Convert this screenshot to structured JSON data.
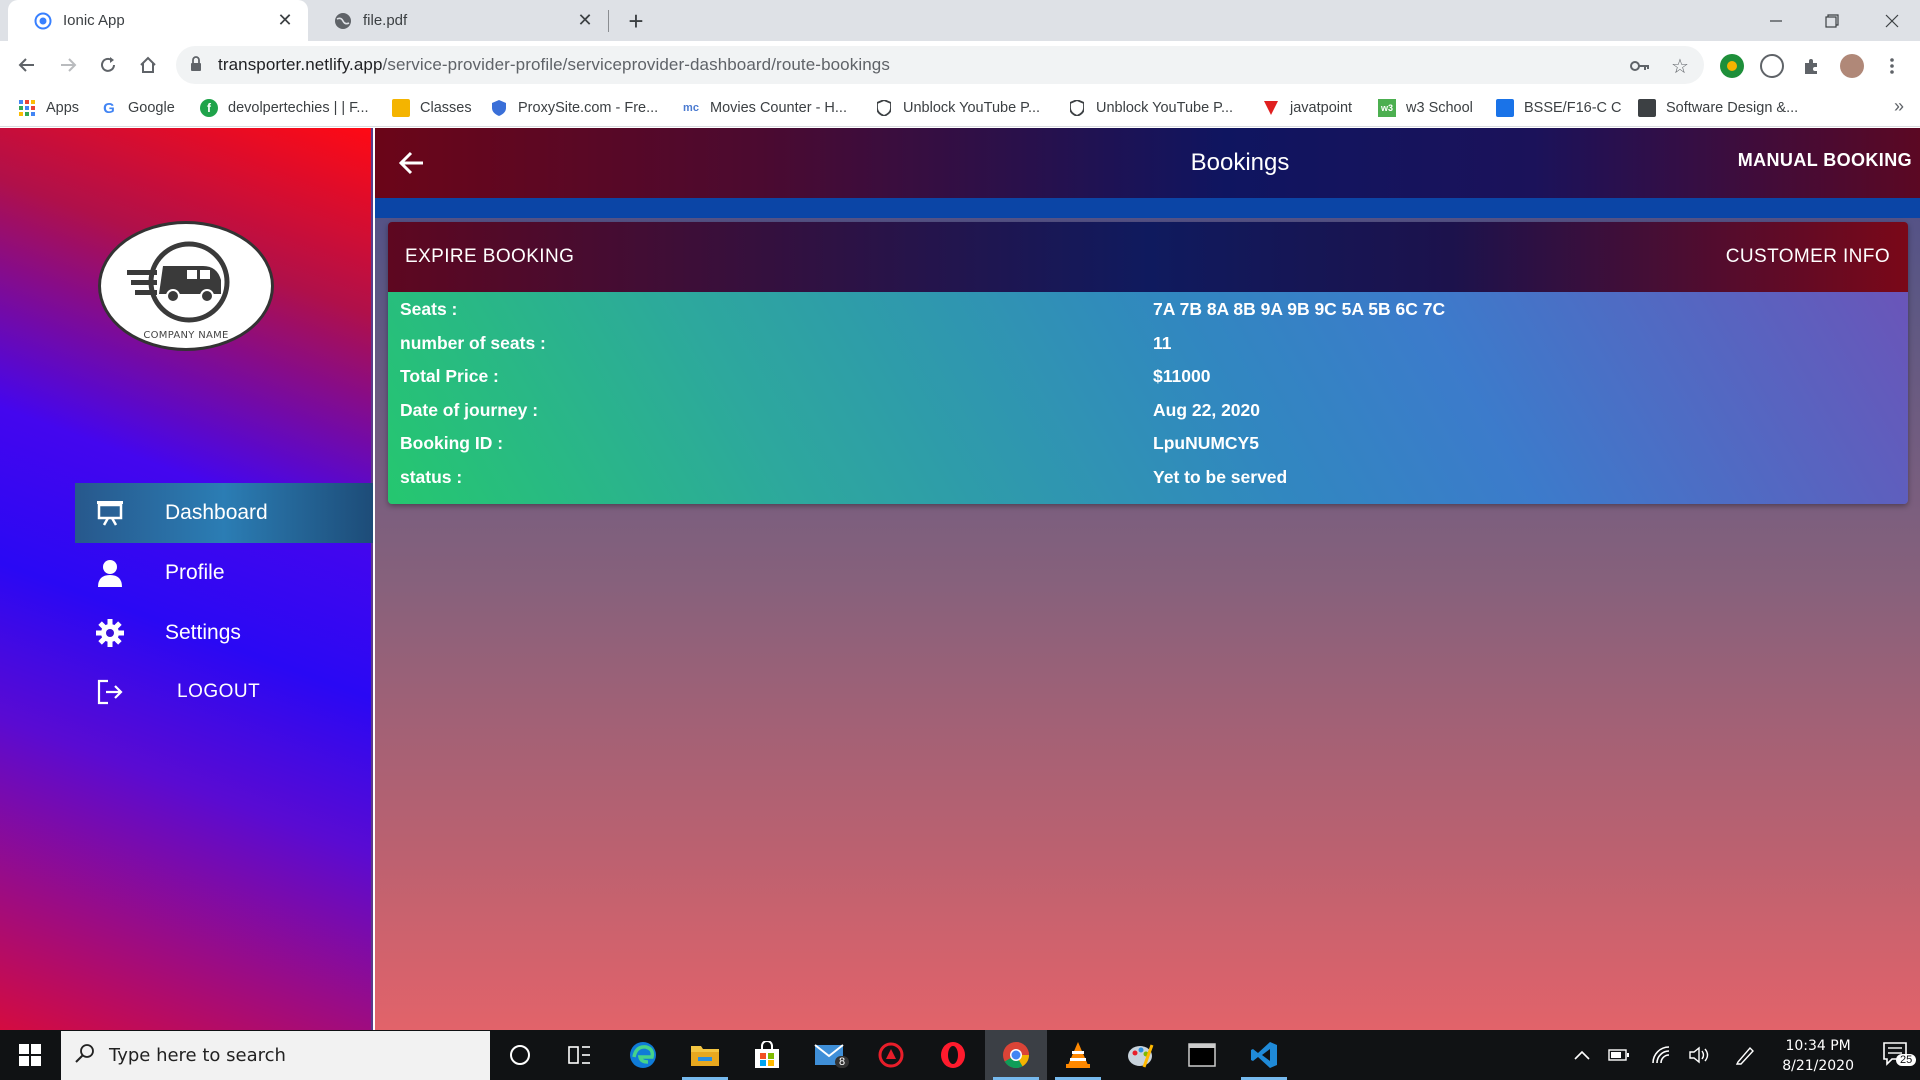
{
  "browser": {
    "tabs": [
      {
        "title": "Ionic App",
        "active": true
      },
      {
        "title": "file.pdf",
        "active": false
      }
    ],
    "url": {
      "host": "transporter.netlify.app",
      "path": "/service-provider-profile/serviceprovider-dashboard/route-bookings"
    },
    "bookmarks": [
      {
        "label": "Apps",
        "icon": "apps-grid-icon"
      },
      {
        "label": "Google",
        "icon": "google-icon"
      },
      {
        "label": "devolpertechies | | F...",
        "icon": "site-icon"
      },
      {
        "label": "Classes",
        "icon": "classroom-icon"
      },
      {
        "label": "ProxySite.com - Fre...",
        "icon": "shield-icon"
      },
      {
        "label": "Movies Counter - H...",
        "icon": "site-icon"
      },
      {
        "label": "Unblock YouTube P...",
        "icon": "shield-icon"
      },
      {
        "label": "Unblock YouTube P...",
        "icon": "shield-icon"
      },
      {
        "label": "javatpoint",
        "icon": "javatpoint-icon"
      },
      {
        "label": "w3 School",
        "icon": "w3-icon"
      },
      {
        "label": "BSSE/F16-C C",
        "icon": "contact-icon"
      },
      {
        "label": "Software Design &...",
        "icon": "contact-icon"
      }
    ]
  },
  "sidebar": {
    "logo_text": "COMPANY NAME",
    "items": [
      {
        "label": "Dashboard",
        "icon": "presentation-icon",
        "active": true
      },
      {
        "label": "Profile",
        "icon": "person-icon",
        "active": false
      },
      {
        "label": "Settings",
        "icon": "gear-icon",
        "active": false
      },
      {
        "label": "LOGOUT",
        "icon": "logout-icon",
        "active": false
      }
    ]
  },
  "header": {
    "title": "Bookings",
    "manual_booking": "MANUAL BOOKING"
  },
  "card": {
    "expire_booking": "EXPIRE BOOKING",
    "customer_info": "CUSTOMER INFO",
    "rows": [
      {
        "label": "Seats :",
        "value": "7A 7B 8A 8B 9A 9B 9C 5A 5B 6C 7C"
      },
      {
        "label": "number of seats :",
        "value": "11"
      },
      {
        "label": "Total Price :",
        "value": "$11000"
      },
      {
        "label": "Date of journey :",
        "value": "Aug 22, 2020"
      },
      {
        "label": "Booking ID :",
        "value": "LpuNUMCY5"
      },
      {
        "label": "status :",
        "value": "Yet to be served"
      }
    ]
  },
  "taskbar": {
    "search_placeholder": "Type here to search",
    "mail_badge": "8",
    "time": "10:34 PM",
    "date": "8/21/2020",
    "notification_count": "25"
  },
  "colors": {
    "accent_blue": "#0b45a6",
    "header_dark": "#0f1560"
  }
}
